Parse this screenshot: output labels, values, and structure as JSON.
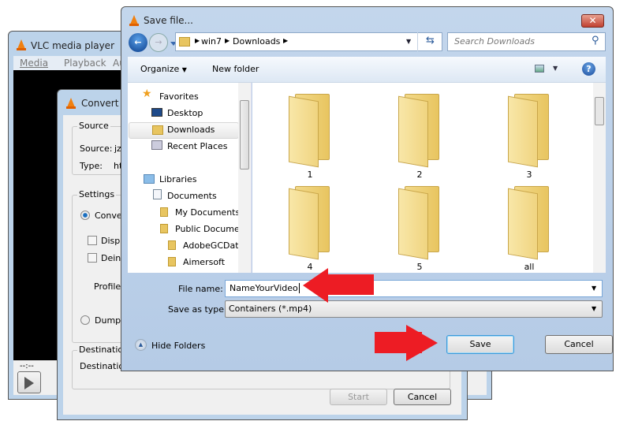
{
  "vlc": {
    "title": "VLC media player",
    "menu": [
      "Media",
      "Playback",
      "Au"
    ],
    "time": "--:--"
  },
  "convert": {
    "title": "Convert",
    "source_group": "Source",
    "source_label": "Source:",
    "source_value": "jz",
    "type_label": "Type:",
    "type_value": "ht",
    "settings_group": "Settings",
    "convert_radio": "Conver",
    "display_check": "Displa",
    "deinterlace_check": "Deint",
    "profile_label": "Profile",
    "dump_radio": "Dump r",
    "destination_group": "Destination",
    "destination_label": "Destination",
    "start_button": "Start",
    "cancel_button": "Cancel"
  },
  "save": {
    "title": "Save file...",
    "breadcrumb": [
      "win7",
      "Downloads"
    ],
    "search_placeholder": "Search Downloads",
    "organize": "Organize",
    "new_folder": "New folder",
    "nav": {
      "favorites": "Favorites",
      "desktop": "Desktop",
      "downloads": "Downloads",
      "recent": "Recent Places",
      "libraries": "Libraries",
      "documents": "Documents",
      "my_documents": "My Documents",
      "public_documents": "Public Docume",
      "adobe": "AdobeGCDat",
      "aimersoft": "Aimersoft"
    },
    "folders": [
      "1",
      "2",
      "3",
      "4",
      "5",
      "all"
    ],
    "file_name_label": "File name:",
    "file_name_value": "NameYourVideo",
    "save_type_label": "Save as type:",
    "save_type_value": "Containers (*.mp4)",
    "hide_folders": "Hide Folders",
    "save_button": "Save",
    "cancel_button": "Cancel"
  },
  "colors": {
    "annotation_arrow": "#ed1c24",
    "accent": "#3a8ad8"
  }
}
